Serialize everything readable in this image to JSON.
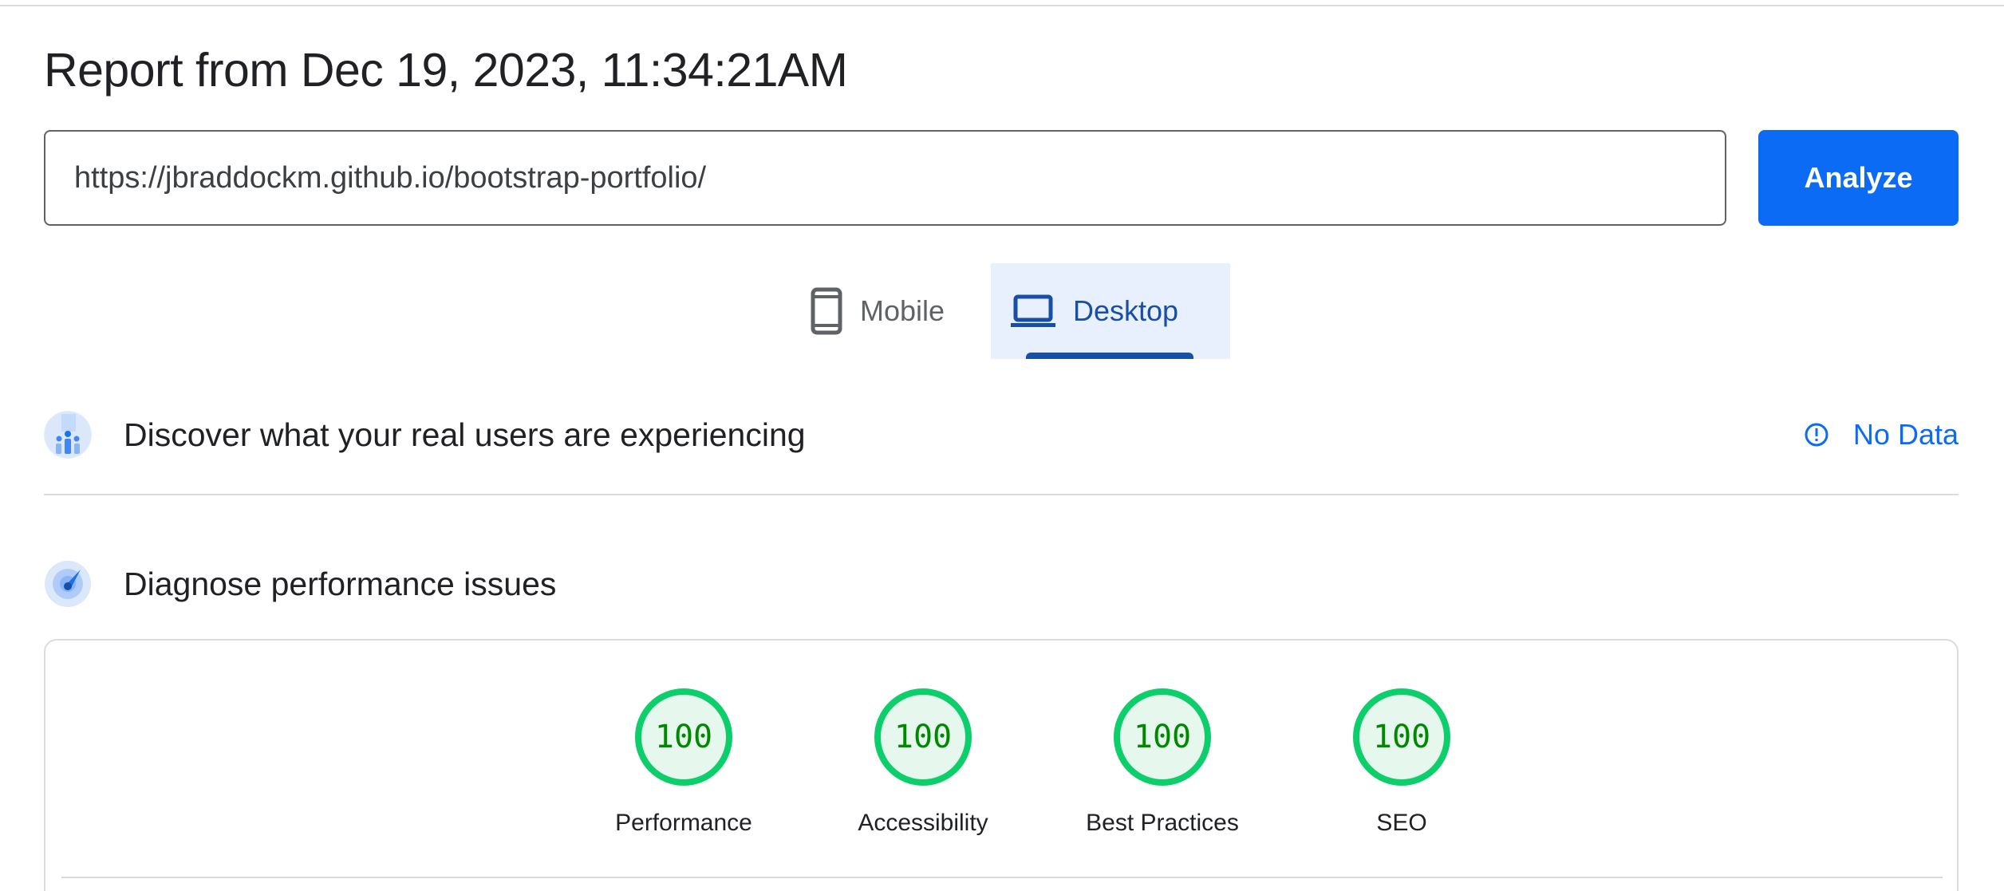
{
  "report": {
    "title": "Report from Dec 19, 2023, 11:34:21AM"
  },
  "url_bar": {
    "value": "https://jbraddockm.github.io/bootstrap-portfolio/",
    "analyze_label": "Analyze"
  },
  "device_tabs": [
    {
      "label": "Mobile",
      "icon": "phone-icon",
      "selected": false
    },
    {
      "label": "Desktop",
      "icon": "laptop-icon",
      "selected": true
    }
  ],
  "crux_section": {
    "title": "Discover what your real users are experiencing",
    "icon": "users-chart-icon",
    "status_label": "No Data",
    "status_icon": "info-icon"
  },
  "diagnose_section": {
    "title": "Diagnose performance issues",
    "icon": "gauge-icon"
  },
  "scores": [
    {
      "label": "Performance",
      "value": "100"
    },
    {
      "label": "Accessibility",
      "value": "100"
    },
    {
      "label": "Best Practices",
      "value": "100"
    },
    {
      "label": "SEO",
      "value": "100"
    }
  ],
  "colors": {
    "accent": "#0b6bf5",
    "selected_tab_bg": "#e8f0fe",
    "selected_tab_text": "#174ea6",
    "score_pass": "#0cce6b",
    "score_pass_text": "#008800"
  }
}
